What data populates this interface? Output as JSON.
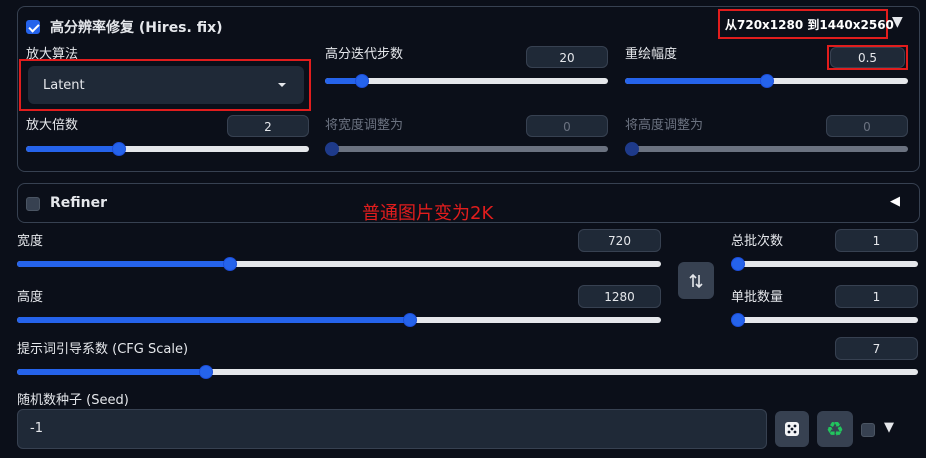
{
  "hires": {
    "title": "高分辨率修复 (Hires. fix)",
    "resolution_note": "从720x1280 到1440x2560",
    "collapse_icon": "triangle-down-icon",
    "upscaler_label": "放大算法",
    "upscaler_value": "Latent",
    "steps_label": "高分迭代步数",
    "steps_value": "20",
    "steps_fraction": 0.13,
    "denoise_label": "重绘幅度",
    "denoise_value": "0.5",
    "denoise_fraction": 0.5,
    "scale_label": "放大倍数",
    "scale_value": "2",
    "scale_fraction": 0.33,
    "resize_w_label": "将宽度调整为",
    "resize_w_value": "0",
    "resize_h_label": "将高度调整为",
    "resize_h_value": "0"
  },
  "refiner": {
    "title": "Refiner",
    "collapse_icon": "triangle-left-icon"
  },
  "annotation": "普通图片变为2K",
  "size": {
    "width_label": "宽度",
    "width_value": "720",
    "width_fraction": 0.33,
    "height_label": "高度",
    "height_value": "1280",
    "height_fraction": 0.61,
    "swap_icon": "swap-arrows-icon"
  },
  "batch": {
    "count_label": "总批次数",
    "count_value": "1",
    "count_fraction": 0.0,
    "size_label": "单批数量",
    "size_value": "1",
    "size_fraction": 0.0
  },
  "cfg": {
    "label": "提示词引导系数 (CFG Scale)",
    "value": "7",
    "fraction": 0.21
  },
  "seed": {
    "label": "随机数种子 (Seed)",
    "value": "-1",
    "dice_icon": "dice-icon",
    "recycle_icon": "recycle-icon",
    "expand_icon": "triangle-down-icon"
  },
  "colors": {
    "accent": "#2563eb",
    "highlight": "#e11d1d",
    "background": "#0b0f19"
  }
}
